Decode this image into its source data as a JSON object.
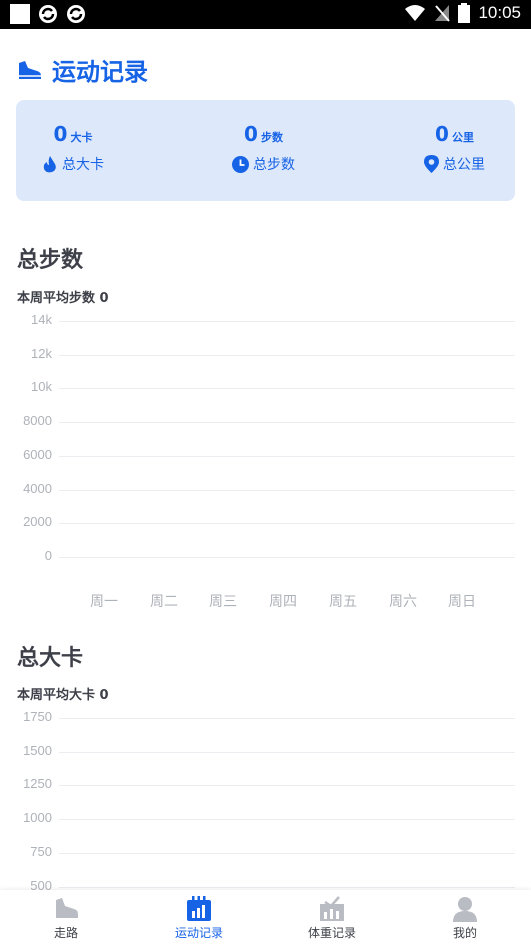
{
  "status_bar": {
    "time": "10:05"
  },
  "header": {
    "title": "运动记录"
  },
  "stats": [
    {
      "value": "0",
      "unit": "大卡",
      "label": "总大卡",
      "icon": "flame-icon"
    },
    {
      "value": "0",
      "unit": "步数",
      "label": "总步数",
      "icon": "clock-icon"
    },
    {
      "value": "0",
      "unit": "公里",
      "label": "总公里",
      "icon": "location-pin-icon"
    }
  ],
  "steps_section": {
    "title": "总步数",
    "subtitle": "本周平均步数 0"
  },
  "calories_section": {
    "title": "总大卡",
    "subtitle": "本周平均大卡 0"
  },
  "chart_data": [
    {
      "type": "line",
      "categories": [
        "周一",
        "周二",
        "周三",
        "周四",
        "周五",
        "周六",
        "周日"
      ],
      "y_ticks": [
        "14k",
        "12k",
        "10k",
        "8000",
        "6000",
        "4000",
        "2000",
        "0"
      ],
      "ylim": [
        0,
        14000
      ],
      "values": [],
      "grid": true
    },
    {
      "type": "line",
      "categories": [],
      "y_ticks": [
        "1750",
        "1500",
        "1250",
        "1000",
        "750",
        "500"
      ],
      "ylim": [
        0,
        1750
      ],
      "values": [],
      "grid": true
    }
  ],
  "tabs": [
    {
      "label": "走路",
      "icon": "shoe-icon",
      "active": false
    },
    {
      "label": "运动记录",
      "icon": "calendar-chart-icon",
      "active": true
    },
    {
      "label": "体重记录",
      "icon": "weight-chart-icon",
      "active": false
    },
    {
      "label": "我的",
      "icon": "user-icon",
      "active": false
    }
  ],
  "colors": {
    "accent": "#1763e6",
    "card_bg": "#dde8fb",
    "text": "#3e4049",
    "muted": "#aeb2b9"
  }
}
